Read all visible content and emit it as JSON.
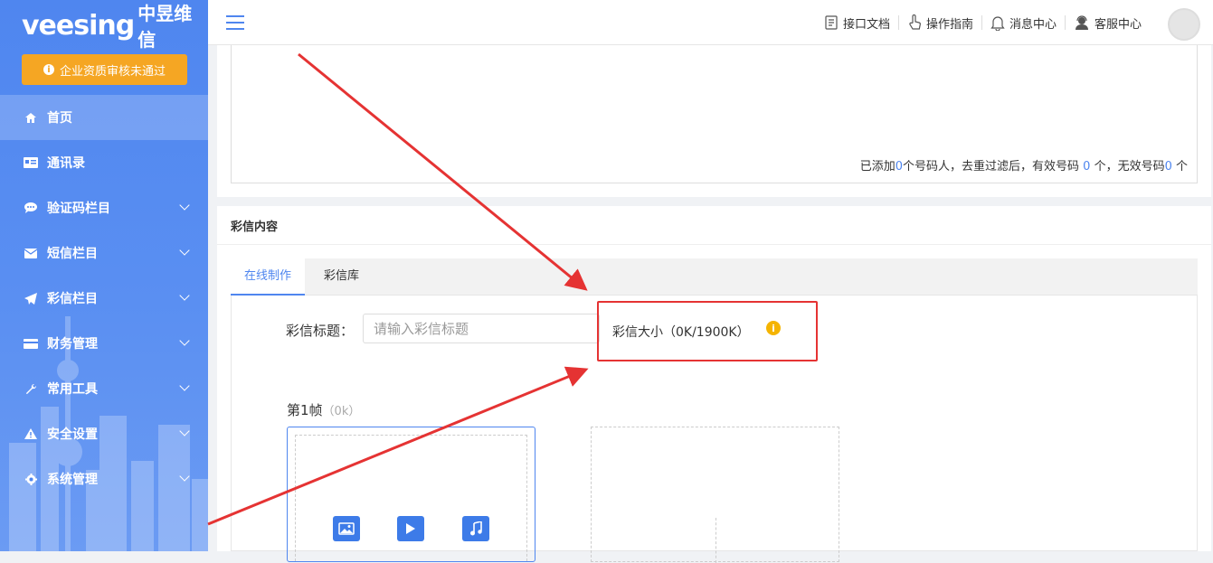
{
  "sidebar": {
    "logo_brand": "veesing",
    "logo_cn": "中昱维信",
    "warning_button": "企业资质审核未通过",
    "items": [
      {
        "label": "首页",
        "icon": "home-icon",
        "active": true,
        "expandable": false
      },
      {
        "label": "通讯录",
        "icon": "contacts-icon",
        "active": false,
        "expandable": false
      },
      {
        "label": "验证码栏目",
        "icon": "chat-bubble-icon",
        "active": false,
        "expandable": true
      },
      {
        "label": "短信栏目",
        "icon": "envelope-icon",
        "active": false,
        "expandable": true
      },
      {
        "label": "彩信栏目",
        "icon": "paper-plane-icon",
        "active": false,
        "expandable": true
      },
      {
        "label": "财务管理",
        "icon": "credit-card-icon",
        "active": false,
        "expandable": true
      },
      {
        "label": "常用工具",
        "icon": "wrench-icon",
        "active": false,
        "expandable": true
      },
      {
        "label": "安全设置",
        "icon": "warning-icon",
        "active": false,
        "expandable": true
      },
      {
        "label": "系统管理",
        "icon": "gear-icon",
        "active": false,
        "expandable": true
      }
    ]
  },
  "topbar": {
    "links": [
      {
        "label": "接口文档",
        "icon": "document-icon"
      },
      {
        "label": "操作指南",
        "icon": "hand-pointer-icon"
      },
      {
        "label": "消息中心",
        "icon": "bell-icon"
      },
      {
        "label": "客服中心",
        "icon": "support-agent-icon"
      }
    ]
  },
  "numbers": {
    "added_prefix": "已添加",
    "added_count": "0",
    "added_suffix": "个号码人，去重过滤后，有效号码 ",
    "valid_count": "0",
    "valid_suffix": " 个，无效号码",
    "invalid_count": "0",
    "invalid_suffix": " 个"
  },
  "mms": {
    "section_title": "彩信内容",
    "tabs": [
      {
        "label": "在线制作",
        "active": true
      },
      {
        "label": "彩信库",
        "active": false
      }
    ],
    "title_label": "彩信标题：",
    "title_placeholder": "请输入彩信标题",
    "size_text": "彩信大小（0K/1900K）",
    "frame_label": "第1帧",
    "frame_size": "（0k）"
  },
  "colors": {
    "sidebar": "#4f86ef",
    "warning": "#f5a623",
    "accent": "#4f86ef",
    "highlight": "#e53333",
    "info": "#f5b400"
  }
}
